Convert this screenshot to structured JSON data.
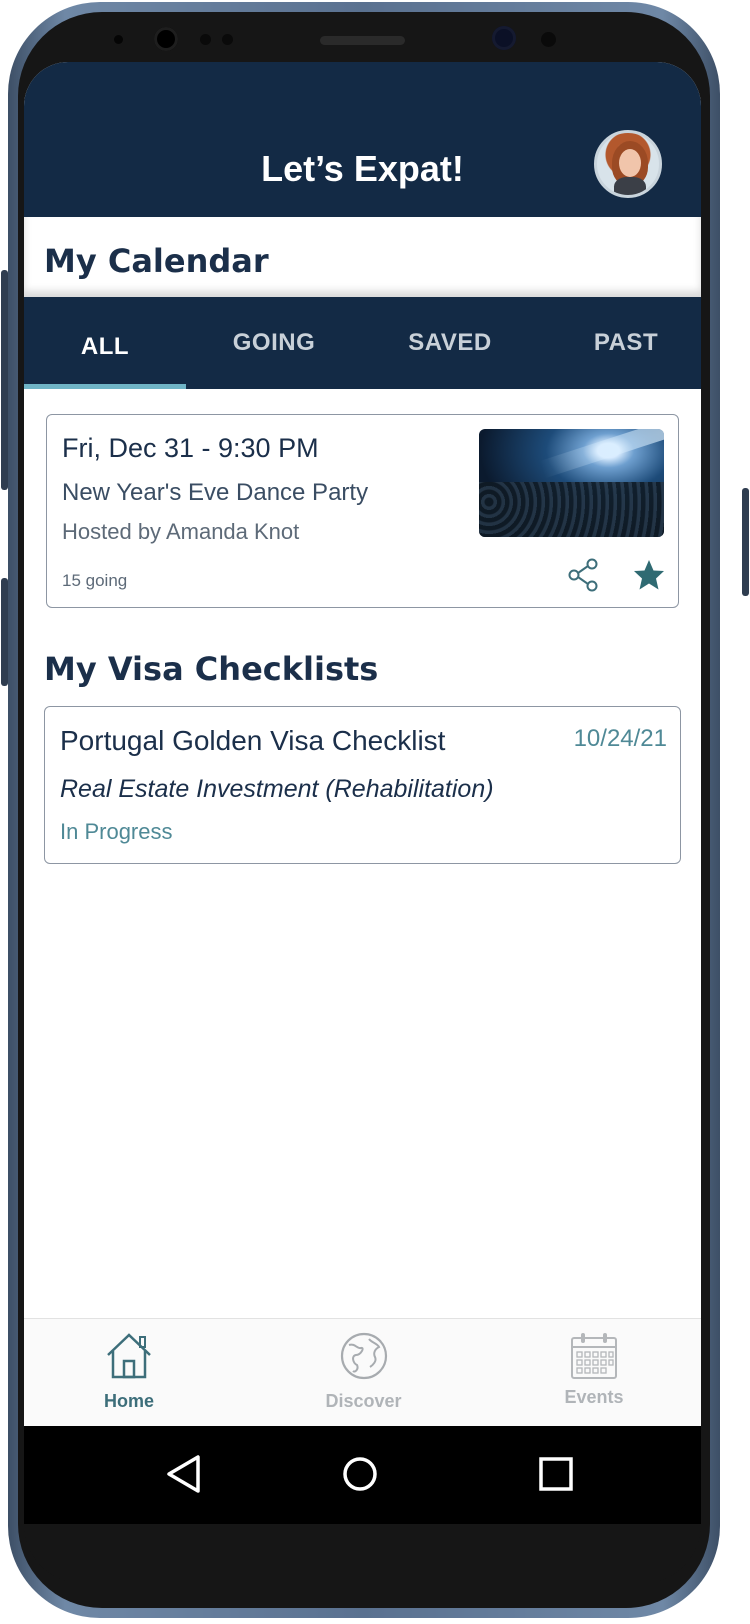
{
  "app": {
    "title": "Let’s Expat!",
    "avatar_icon": "user-avatar"
  },
  "calendar": {
    "section_title": "My Calendar",
    "tabs": [
      {
        "label": "ALL",
        "active": true
      },
      {
        "label": "GOING",
        "active": false
      },
      {
        "label": "SAVED",
        "active": false
      },
      {
        "label": "PAST",
        "active": false
      }
    ],
    "event": {
      "datetime": "Fri, Dec 31 - 9:30 PM",
      "name": "New Year's Eve Dance Party",
      "host": "Hosted by Amanda Knot",
      "going": "15 going",
      "image_icon": "party-crowd-photo",
      "share_icon": "share-icon",
      "star_icon": "star-icon"
    }
  },
  "visa": {
    "section_title": "My Visa Checklists",
    "checklist": {
      "name": "Portugal Golden Visa Checklist",
      "date": "10/24/21",
      "type": "Real Estate Investment (Rehabilitation)",
      "status": "In Progress"
    }
  },
  "bottom_nav": {
    "items": [
      {
        "label": "Home",
        "icon": "home-icon",
        "active": true
      },
      {
        "label": "Discover",
        "icon": "globe-icon",
        "active": false
      },
      {
        "label": "Events",
        "icon": "calendar-icon",
        "active": false
      }
    ]
  },
  "colors": {
    "header": "#132a45",
    "accent": "#6fb4c6",
    "teal": "#3d6e7a",
    "text_dark": "#1b2f4a"
  }
}
